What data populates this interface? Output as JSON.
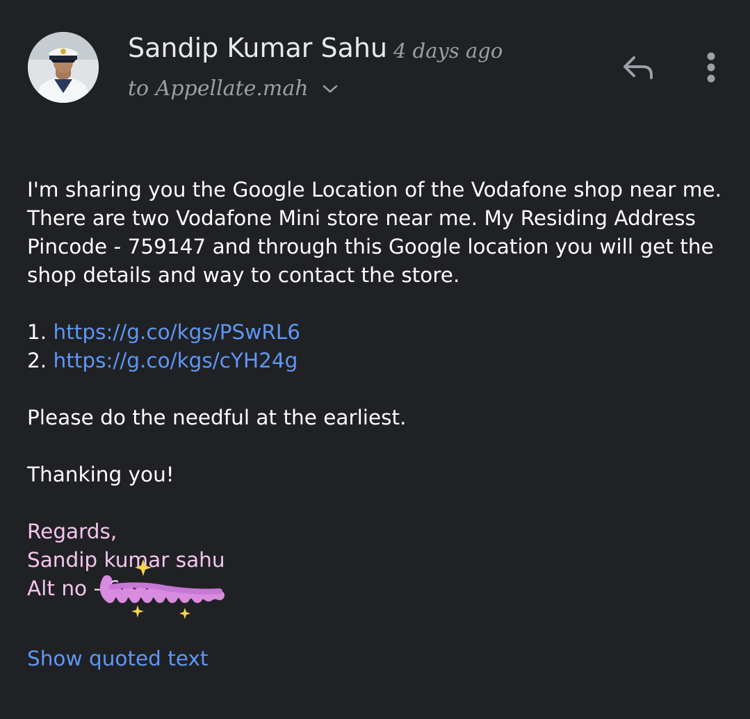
{
  "header": {
    "sender_name": "Sandip Kumar Sahu",
    "timestamp": "4 days ago",
    "recipient": "to Appellate.mah"
  },
  "icons": {
    "avatar": "sender-avatar-photo",
    "details": "chevron-down-icon",
    "reply": "reply-arrow-icon",
    "more": "more-vert-icon"
  },
  "body": {
    "paragraph_1": "I'm sharing you the Google Location of the Vodafone shop near me. There are two Vodafone Mini store near me. My Residing Address Pincode - 759147 and through this Google location you will get the shop details and way to contact the store.",
    "links": [
      {
        "number": "1.",
        "url": "https://g.co/kgs/PSwRL6"
      },
      {
        "number": "2.",
        "url": "https://g.co/kgs/cYH24g"
      }
    ],
    "paragraph_2": "Please do the needful at the earliest.",
    "paragraph_3": "Thanking you!",
    "signature": {
      "regards": "Regards,",
      "name": "Sandip kumar sahu",
      "alt_prefix": "Alt no - ",
      "alt_visible_digits": "6"
    }
  },
  "footer": {
    "show_quoted": "Show quoted text"
  },
  "colors": {
    "background": "#202124",
    "link": "#5e97f6",
    "signature": "#f3c6ee",
    "secondary_text": "#9aa0a6",
    "scribble": "#d98be0"
  }
}
